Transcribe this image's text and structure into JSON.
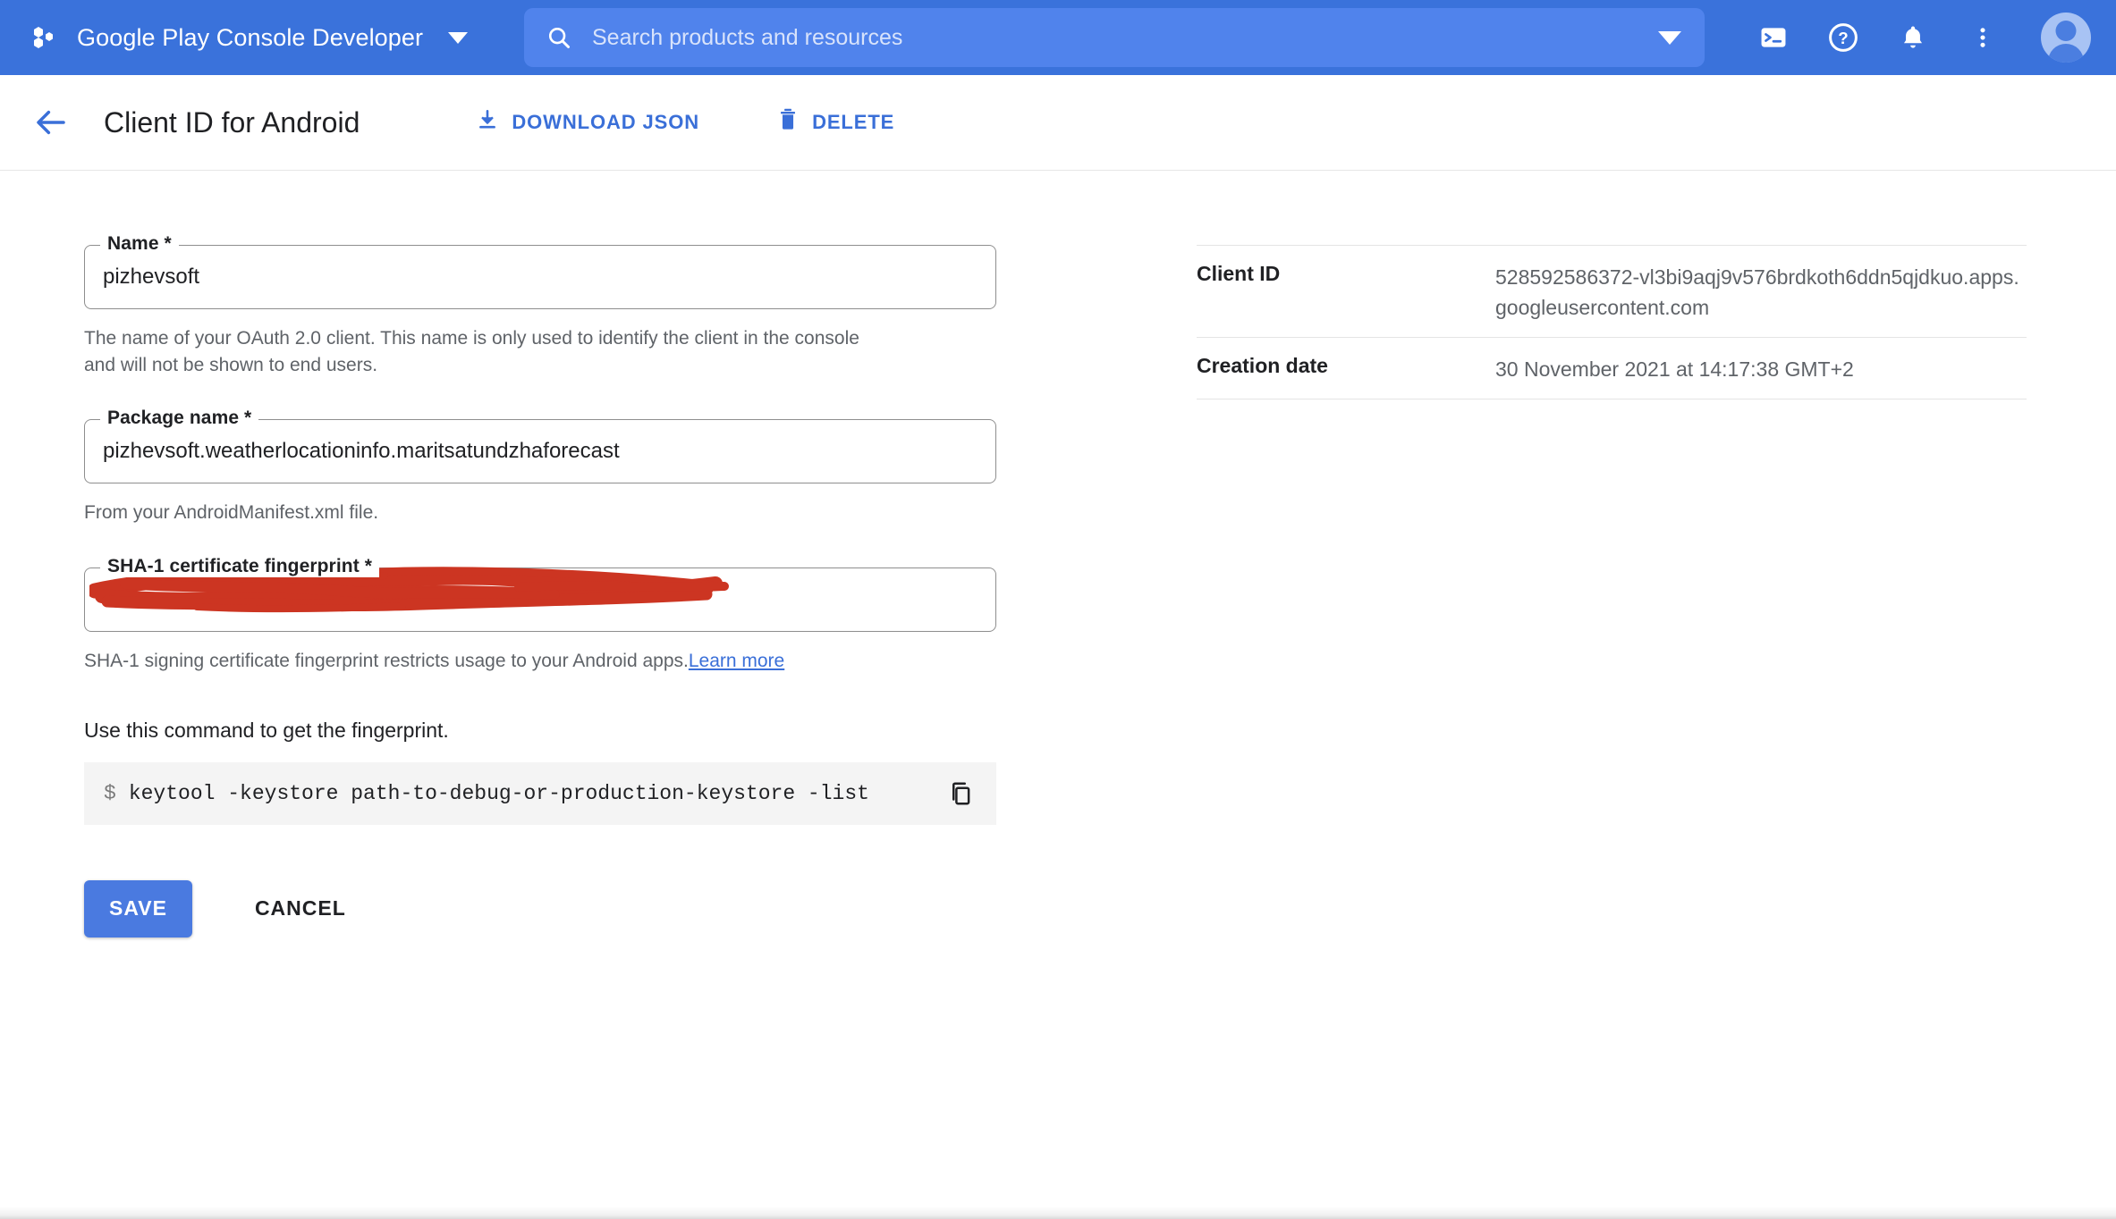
{
  "topbar": {
    "brand_label": "Google Play Console Developer",
    "brand_logo_icon": "google-cloud-hexagon-logo",
    "brand_caret_icon": "chevron-down-icon",
    "search": {
      "placeholder": "Search products and resources",
      "value": "",
      "icon": "search-icon",
      "caret_icon": "chevron-down-icon"
    },
    "icons": [
      {
        "name": "cloud-shell-icon",
        "title": "Activate Cloud Shell"
      },
      {
        "name": "help-icon",
        "title": "Help"
      },
      {
        "name": "notifications-bell-icon",
        "title": "Notifications"
      },
      {
        "name": "more-vert-icon",
        "title": "More options"
      }
    ],
    "avatar_icon": "account-avatar"
  },
  "pagehead": {
    "back_icon": "arrow-back-icon",
    "title": "Client ID for Android",
    "actions": [
      {
        "label": "DOWNLOAD JSON",
        "icon": "download-icon"
      },
      {
        "label": "DELETE",
        "icon": "trash-icon"
      }
    ]
  },
  "form": {
    "name_field": {
      "label": "Name *",
      "value": "pizhevsoft",
      "helper": "The name of your OAuth 2.0 client. This name is only used to identify the client in the console and will not be shown to end users."
    },
    "package_field": {
      "label": "Package name *",
      "value": "pizhevsoft.weatherlocationinfo.maritsatundzhaforecast",
      "helper": "From your AndroidManifest.xml file."
    },
    "sha1_field": {
      "label": "SHA-1 certificate fingerprint *",
      "value": "",
      "redacted": true,
      "redaction_color": "#cc3522",
      "helper_text": "SHA-1 signing certificate fingerprint restricts usage to your Android apps.",
      "helper_link": "Learn more"
    },
    "command": {
      "label": "Use this command to get the fingerprint.",
      "prompt": "$",
      "text": "keytool -keystore path-to-debug-or-production-keystore -list",
      "copy_icon": "copy-icon"
    },
    "save_label": "SAVE",
    "cancel_label": "CANCEL"
  },
  "details": [
    {
      "key": "Client ID",
      "value": "528592586372-vl3bi9aqj9v576brdkoth6ddn5qjdkuo.apps.googleusercontent.com"
    },
    {
      "key": "Creation date",
      "value": "30 November 2021 at 14:17:38 GMT+2"
    }
  ],
  "colors": {
    "header_blue": "#3a72db",
    "search_blue": "#5083ec",
    "accent_blue": "#3a6fd8",
    "save_blue": "#4a7ae0",
    "redaction_red": "#cc3522",
    "code_bg": "#f4f4f4",
    "text_primary": "#202124",
    "text_secondary": "#5f6368"
  }
}
